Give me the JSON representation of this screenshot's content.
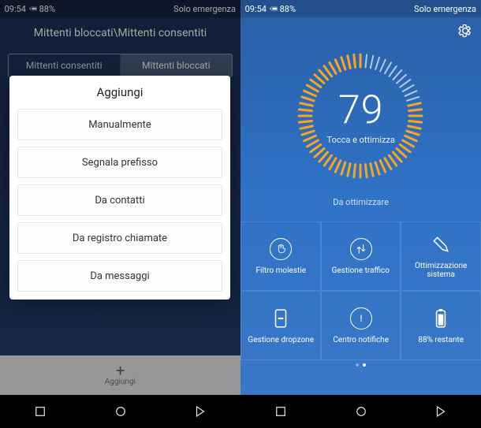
{
  "status": {
    "carrier": "Solo emergenza",
    "time": "09:54",
    "battery_pct": "88%"
  },
  "left_screen": {
    "score": "79",
    "tap_label": "Tocca e ottimizza",
    "sub_label": "Da ottimizzare",
    "tiles": [
      {
        "label": "Ottimizzazione sistema",
        "icon": "brush"
      },
      {
        "label": "Gestione traffico",
        "icon": "updown"
      },
      {
        "label": "Filtro molestie",
        "icon": "hand"
      },
      {
        "label": "88% restante",
        "icon": "battery"
      },
      {
        "label": "Centro notifiche",
        "icon": "alert"
      },
      {
        "label": "Gestione dropzone",
        "icon": "phone"
      }
    ]
  },
  "right_screen": {
    "title": "Mittenti bloccati\\Mittenti consentiti",
    "tabs": {
      "blocked": "Mittenti bloccati",
      "allowed": "Mittenti consentiti"
    },
    "dialog": {
      "title": "Aggiungi",
      "options": [
        "Manualmente",
        "Segnala prefisso",
        "Da contatti",
        "Da registro chiamate",
        "Da messaggi"
      ]
    },
    "bottom_add": "Aggiungi"
  }
}
